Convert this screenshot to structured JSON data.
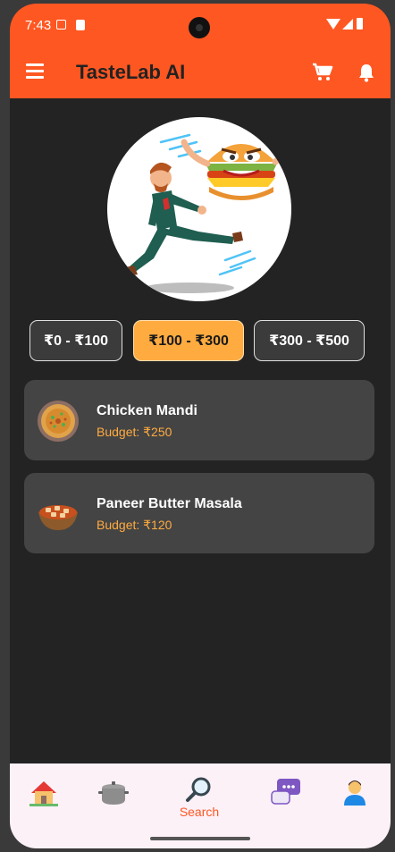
{
  "status_bar": {
    "time": "7:43"
  },
  "app_bar": {
    "title": "TasteLab AI",
    "icons": [
      "menu-icon",
      "cart-icon",
      "bell-icon"
    ]
  },
  "hero": {
    "image": "cartoon man running from burger"
  },
  "price_filters": [
    {
      "label": "₹0 - ₹100",
      "selected": false
    },
    {
      "label": "₹100 - ₹300",
      "selected": true
    },
    {
      "label": "₹300 - ₹500",
      "selected": false
    }
  ],
  "results": [
    {
      "name": "Chicken Mandi",
      "budget": "Budget: ₹250",
      "icon": "chicken-mandi-plate"
    },
    {
      "name": "Paneer Butter Masala",
      "budget": "Budget: ₹120",
      "icon": "paneer-bowl"
    }
  ],
  "bottom_nav": {
    "items": [
      "home-icon",
      "pot-icon",
      "search-icon",
      "chat-icon",
      "profile-icon"
    ],
    "active_label": "Search"
  },
  "colors": {
    "brand": "#ff5722",
    "accent": "#ffab40",
    "background": "#232323",
    "card": "#444444"
  }
}
